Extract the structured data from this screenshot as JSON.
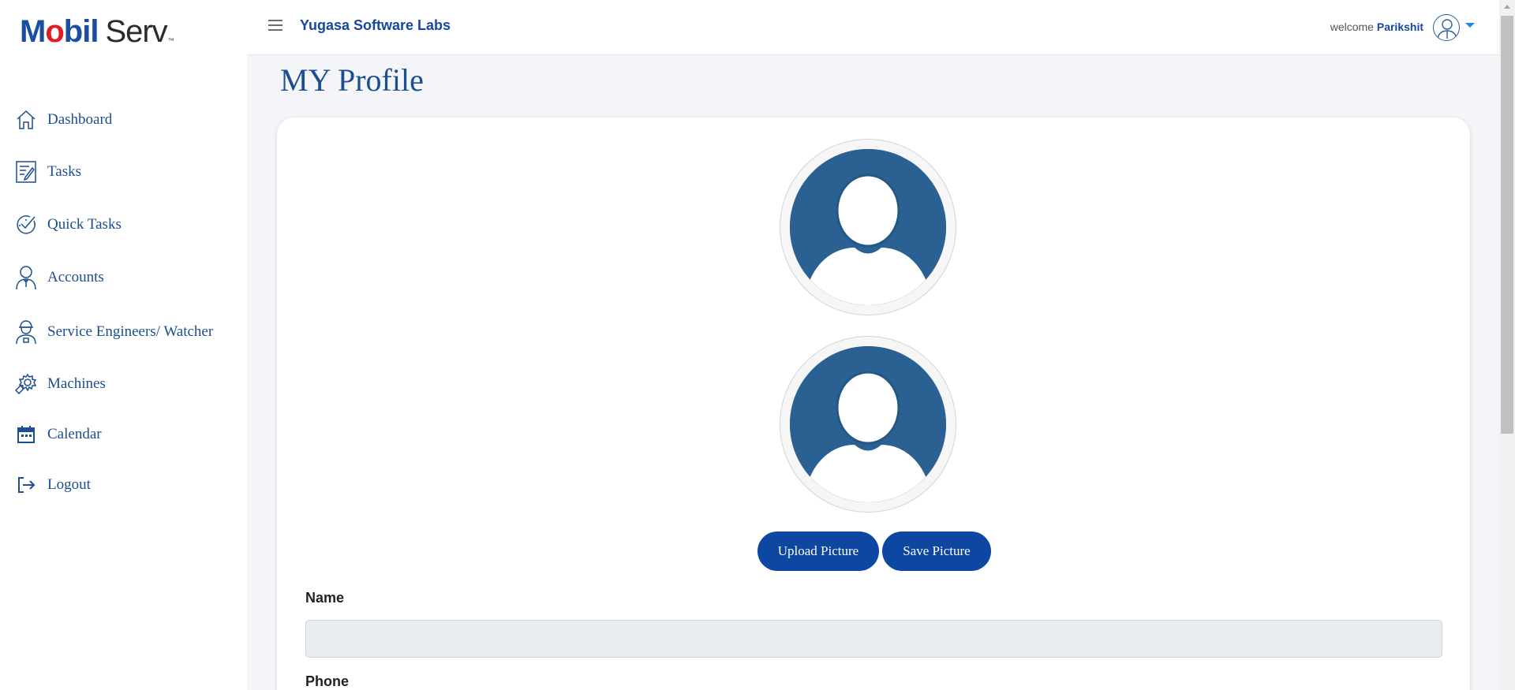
{
  "brand": {
    "logo_part1": "M",
    "logo_part2": "o",
    "logo_part3": "bil",
    "logo_part4": "Serv",
    "logo_tm": "™"
  },
  "sidebar": {
    "items": [
      {
        "label": "Dashboard",
        "icon": "home-icon"
      },
      {
        "label": "Tasks",
        "icon": "tasks-icon"
      },
      {
        "label": "Quick Tasks",
        "icon": "quick-tasks-icon"
      },
      {
        "label": "Accounts",
        "icon": "accounts-icon"
      },
      {
        "label": "Service Engineers/ Watcher",
        "icon": "engineer-icon"
      },
      {
        "label": "Machines",
        "icon": "machines-icon"
      },
      {
        "label": "Calendar",
        "icon": "calendar-icon"
      },
      {
        "label": "Logout",
        "icon": "logout-icon"
      }
    ]
  },
  "header": {
    "company": "Yugasa Software Labs",
    "welcome_prefix": "welcome",
    "user_name": "Parikshit"
  },
  "main": {
    "title": "MY Profile",
    "upload_label": "Upload Picture",
    "save_label": "Save Picture",
    "fields": [
      {
        "label": "Name",
        "value": ""
      },
      {
        "label": "Phone",
        "value": ""
      }
    ]
  },
  "colors": {
    "brand_blue": "#1b4f8f",
    "button_blue": "#0d47a1",
    "avatar_blue": "#2a6192",
    "logo_red": "#e31b23"
  }
}
